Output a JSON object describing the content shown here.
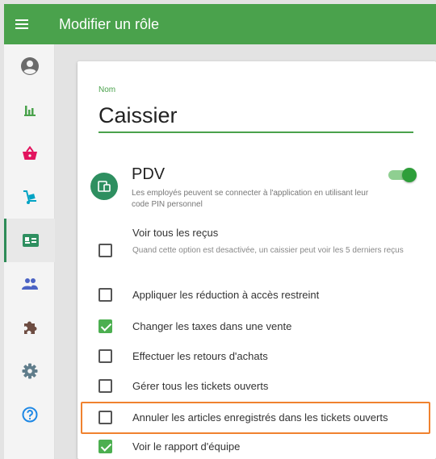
{
  "header": {
    "title": "Modifier un rôle"
  },
  "sidebar": {
    "items": [
      {
        "name": "account",
        "color": "#6b6b6b"
      },
      {
        "name": "reports",
        "color": "#4aa24c"
      },
      {
        "name": "items",
        "color": "#e2145e"
      },
      {
        "name": "inventory",
        "color": "#00a3c4"
      },
      {
        "name": "employees",
        "color": "#2e8f60",
        "active": true
      },
      {
        "name": "customers",
        "color": "#4b63c4"
      },
      {
        "name": "integrations",
        "color": "#6d4c41"
      },
      {
        "name": "settings",
        "color": "#607d8b"
      },
      {
        "name": "help",
        "color": "#1e88e5"
      }
    ]
  },
  "form": {
    "name_label": "Nom",
    "name_value": "Caissier"
  },
  "pdv": {
    "title": "PDV",
    "description": "Les employés peuvent se connecter à l'application en utilisant leur code PIN personnel",
    "enabled": true
  },
  "permissions": [
    {
      "label": "Voir tous les reçus",
      "description": "Quand cette option est desactivée, un caissier peut voir les 5 derniers reçus",
      "checked": false
    },
    {
      "label": "Appliquer les réduction à accès restreint",
      "checked": false
    },
    {
      "label": "Changer les taxes dans une vente",
      "checked": true
    },
    {
      "label": "Effectuer les retours d'achats",
      "checked": false
    },
    {
      "label": "Gérer tous les tickets ouverts",
      "checked": false
    },
    {
      "label": "Annuler les articles enregistrés dans les tickets ouverts",
      "checked": false,
      "highlighted": true
    },
    {
      "label": "Voir le rapport d'équipe",
      "checked": true
    }
  ],
  "colors": {
    "accent": "#4aa24c",
    "highlight": "#f0822f"
  }
}
